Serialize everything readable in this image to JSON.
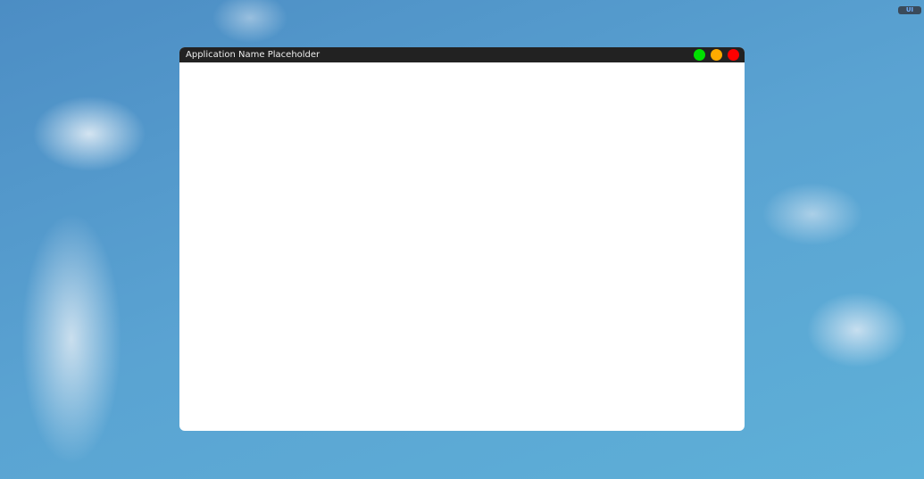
{
  "desktop": {
    "badge": "UI"
  },
  "window": {
    "title": "Application Name Placeholder",
    "buttons": [
      {
        "name": "maximize",
        "color": "#00e000"
      },
      {
        "name": "minimize",
        "color": "#ffaa00"
      },
      {
        "name": "close",
        "color": "#ff0000"
      }
    ]
  }
}
